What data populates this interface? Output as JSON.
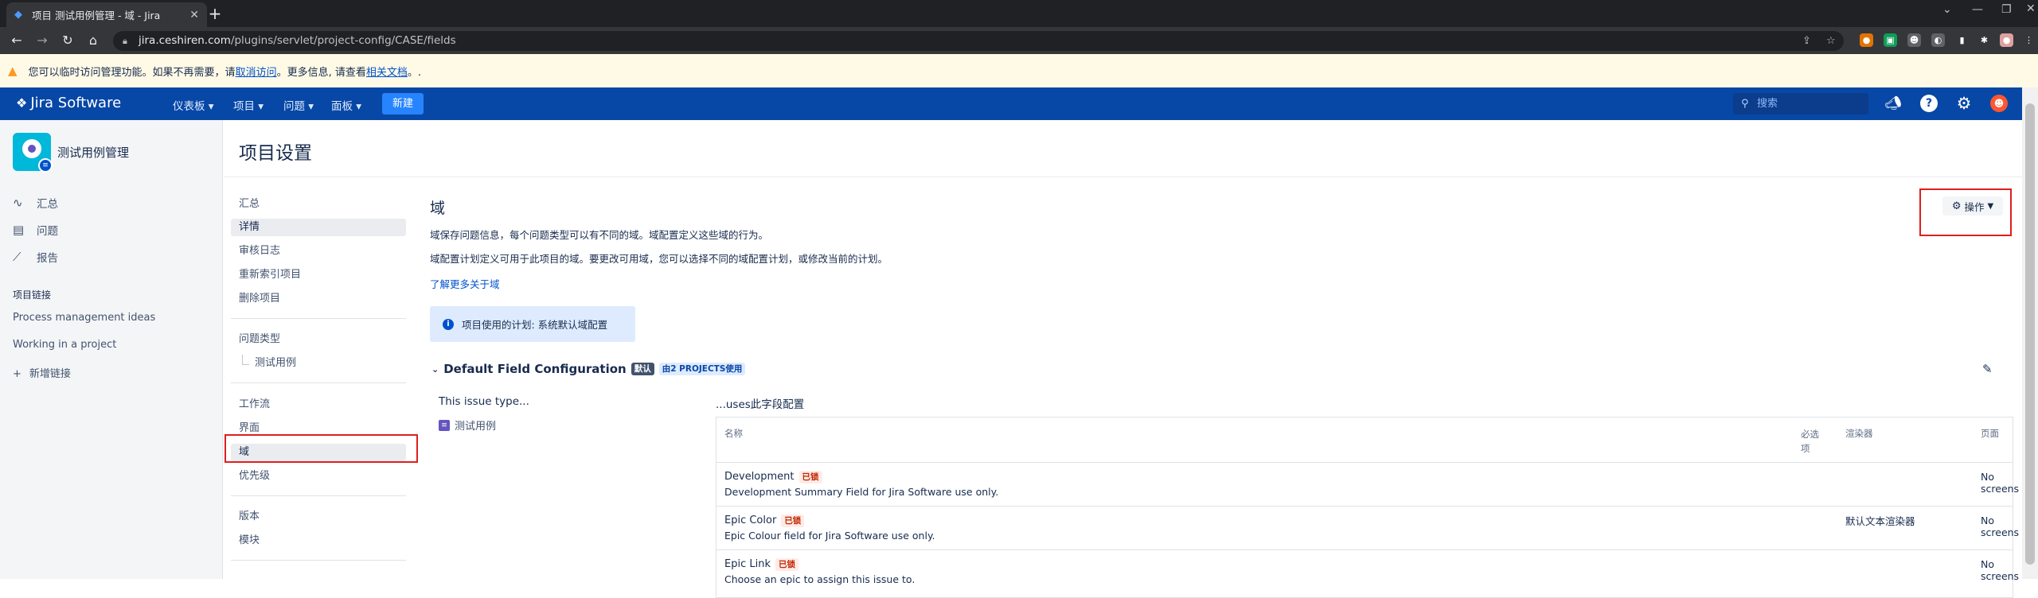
{
  "browser": {
    "tab_title": "项目 测试用例管理 - 域 - Jira",
    "url_host": "jira.ceshiren.com",
    "url_path": "/plugins/servlet/project-config/CASE/fields"
  },
  "warning": {
    "text_before": "您可以临时访问管理功能。如果不再需要，请 ",
    "link_cancel": "取消访问",
    "text_mid": "。更多信息, 请查看 ",
    "link_docs": "相关文档",
    "text_after": "。."
  },
  "topnav": {
    "logo": "Jira Software",
    "menus": [
      "仪表板",
      "项目",
      "问题",
      "面板"
    ],
    "create": "新建",
    "search_placeholder": "搜索"
  },
  "sidebar": {
    "project_name": "测试用例管理",
    "nav": [
      {
        "icon": "pulse-icon",
        "label": "汇总"
      },
      {
        "icon": "issues-icon",
        "label": "问题"
      },
      {
        "icon": "report-icon",
        "label": "报告"
      }
    ],
    "links_title": "项目链接",
    "links": [
      "Process management ideas",
      "Working in a project"
    ],
    "add_link": "新增链接"
  },
  "page_title": "项目设置",
  "settings_nav": {
    "items": [
      "汇总",
      "详情",
      "审核日志",
      "重新索引项目",
      "删除项目",
      "问题类型",
      "测试用例",
      "工作流",
      "界面",
      "域",
      "优先级",
      "版本",
      "模块"
    ]
  },
  "fields": {
    "title": "域",
    "desc1": "域保存问题信息，每个问题类型可以有不同的域。域配置定义这些域的行为。",
    "desc2": "域配置计划定义可用于此项目的域。要更改可用域，您可以选择不同的域配置计划，或修改当前的计划。",
    "learn_more": "了解更多关于域",
    "info": "项目使用的计划: 系统默认域配置",
    "actions": "操作",
    "config_name": "Default Field Configuration",
    "default_badge": "默认",
    "projects_badge": "由2 PROJECTS使用",
    "issue_type_header": "This issue type...",
    "issue_type": "测试用例",
    "uses_header": "...uses此字段配置",
    "columns": {
      "name": "名称",
      "required": "必选项",
      "renderer": "渲染器",
      "screens": "页面"
    },
    "rows": [
      {
        "name": "Development",
        "badge": "已锁",
        "desc": "Development Summary Field for Jira Software use only.",
        "renderer": "",
        "screens": "No screens"
      },
      {
        "name": "Epic Color",
        "badge": "已锁",
        "desc": "Epic Colour field for Jira Software use only.",
        "renderer": "默认文本渲染器",
        "screens": "No screens"
      },
      {
        "name": "Epic Link",
        "badge": "已锁",
        "desc": "Choose an epic to assign this issue to.",
        "renderer": "",
        "screens": "No screens"
      }
    ]
  }
}
